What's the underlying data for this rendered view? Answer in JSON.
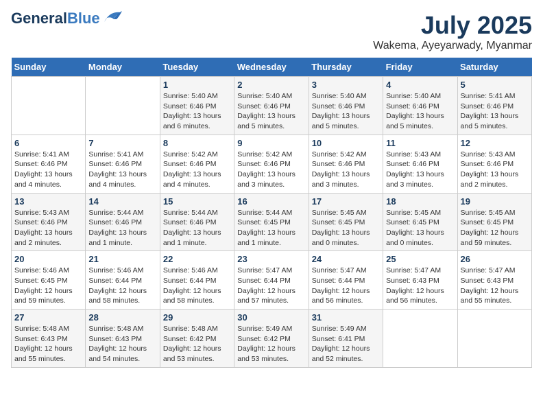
{
  "header": {
    "logo_general": "General",
    "logo_blue": "Blue",
    "month": "July 2025",
    "location": "Wakema, Ayeyarwady, Myanmar"
  },
  "days_of_week": [
    "Sunday",
    "Monday",
    "Tuesday",
    "Wednesday",
    "Thursday",
    "Friday",
    "Saturday"
  ],
  "weeks": [
    [
      {
        "day": "",
        "info": ""
      },
      {
        "day": "",
        "info": ""
      },
      {
        "day": "1",
        "info": "Sunrise: 5:40 AM\nSunset: 6:46 PM\nDaylight: 13 hours and 6 minutes."
      },
      {
        "day": "2",
        "info": "Sunrise: 5:40 AM\nSunset: 6:46 PM\nDaylight: 13 hours and 5 minutes."
      },
      {
        "day": "3",
        "info": "Sunrise: 5:40 AM\nSunset: 6:46 PM\nDaylight: 13 hours and 5 minutes."
      },
      {
        "day": "4",
        "info": "Sunrise: 5:40 AM\nSunset: 6:46 PM\nDaylight: 13 hours and 5 minutes."
      },
      {
        "day": "5",
        "info": "Sunrise: 5:41 AM\nSunset: 6:46 PM\nDaylight: 13 hours and 5 minutes."
      }
    ],
    [
      {
        "day": "6",
        "info": "Sunrise: 5:41 AM\nSunset: 6:46 PM\nDaylight: 13 hours and 4 minutes."
      },
      {
        "day": "7",
        "info": "Sunrise: 5:41 AM\nSunset: 6:46 PM\nDaylight: 13 hours and 4 minutes."
      },
      {
        "day": "8",
        "info": "Sunrise: 5:42 AM\nSunset: 6:46 PM\nDaylight: 13 hours and 4 minutes."
      },
      {
        "day": "9",
        "info": "Sunrise: 5:42 AM\nSunset: 6:46 PM\nDaylight: 13 hours and 3 minutes."
      },
      {
        "day": "10",
        "info": "Sunrise: 5:42 AM\nSunset: 6:46 PM\nDaylight: 13 hours and 3 minutes."
      },
      {
        "day": "11",
        "info": "Sunrise: 5:43 AM\nSunset: 6:46 PM\nDaylight: 13 hours and 3 minutes."
      },
      {
        "day": "12",
        "info": "Sunrise: 5:43 AM\nSunset: 6:46 PM\nDaylight: 13 hours and 2 minutes."
      }
    ],
    [
      {
        "day": "13",
        "info": "Sunrise: 5:43 AM\nSunset: 6:46 PM\nDaylight: 13 hours and 2 minutes."
      },
      {
        "day": "14",
        "info": "Sunrise: 5:44 AM\nSunset: 6:46 PM\nDaylight: 13 hours and 1 minute."
      },
      {
        "day": "15",
        "info": "Sunrise: 5:44 AM\nSunset: 6:46 PM\nDaylight: 13 hours and 1 minute."
      },
      {
        "day": "16",
        "info": "Sunrise: 5:44 AM\nSunset: 6:45 PM\nDaylight: 13 hours and 1 minute."
      },
      {
        "day": "17",
        "info": "Sunrise: 5:45 AM\nSunset: 6:45 PM\nDaylight: 13 hours and 0 minutes."
      },
      {
        "day": "18",
        "info": "Sunrise: 5:45 AM\nSunset: 6:45 PM\nDaylight: 13 hours and 0 minutes."
      },
      {
        "day": "19",
        "info": "Sunrise: 5:45 AM\nSunset: 6:45 PM\nDaylight: 12 hours and 59 minutes."
      }
    ],
    [
      {
        "day": "20",
        "info": "Sunrise: 5:46 AM\nSunset: 6:45 PM\nDaylight: 12 hours and 59 minutes."
      },
      {
        "day": "21",
        "info": "Sunrise: 5:46 AM\nSunset: 6:44 PM\nDaylight: 12 hours and 58 minutes."
      },
      {
        "day": "22",
        "info": "Sunrise: 5:46 AM\nSunset: 6:44 PM\nDaylight: 12 hours and 58 minutes."
      },
      {
        "day": "23",
        "info": "Sunrise: 5:47 AM\nSunset: 6:44 PM\nDaylight: 12 hours and 57 minutes."
      },
      {
        "day": "24",
        "info": "Sunrise: 5:47 AM\nSunset: 6:44 PM\nDaylight: 12 hours and 56 minutes."
      },
      {
        "day": "25",
        "info": "Sunrise: 5:47 AM\nSunset: 6:43 PM\nDaylight: 12 hours and 56 minutes."
      },
      {
        "day": "26",
        "info": "Sunrise: 5:47 AM\nSunset: 6:43 PM\nDaylight: 12 hours and 55 minutes."
      }
    ],
    [
      {
        "day": "27",
        "info": "Sunrise: 5:48 AM\nSunset: 6:43 PM\nDaylight: 12 hours and 55 minutes."
      },
      {
        "day": "28",
        "info": "Sunrise: 5:48 AM\nSunset: 6:43 PM\nDaylight: 12 hours and 54 minutes."
      },
      {
        "day": "29",
        "info": "Sunrise: 5:48 AM\nSunset: 6:42 PM\nDaylight: 12 hours and 53 minutes."
      },
      {
        "day": "30",
        "info": "Sunrise: 5:49 AM\nSunset: 6:42 PM\nDaylight: 12 hours and 53 minutes."
      },
      {
        "day": "31",
        "info": "Sunrise: 5:49 AM\nSunset: 6:41 PM\nDaylight: 12 hours and 52 minutes."
      },
      {
        "day": "",
        "info": ""
      },
      {
        "day": "",
        "info": ""
      }
    ]
  ]
}
